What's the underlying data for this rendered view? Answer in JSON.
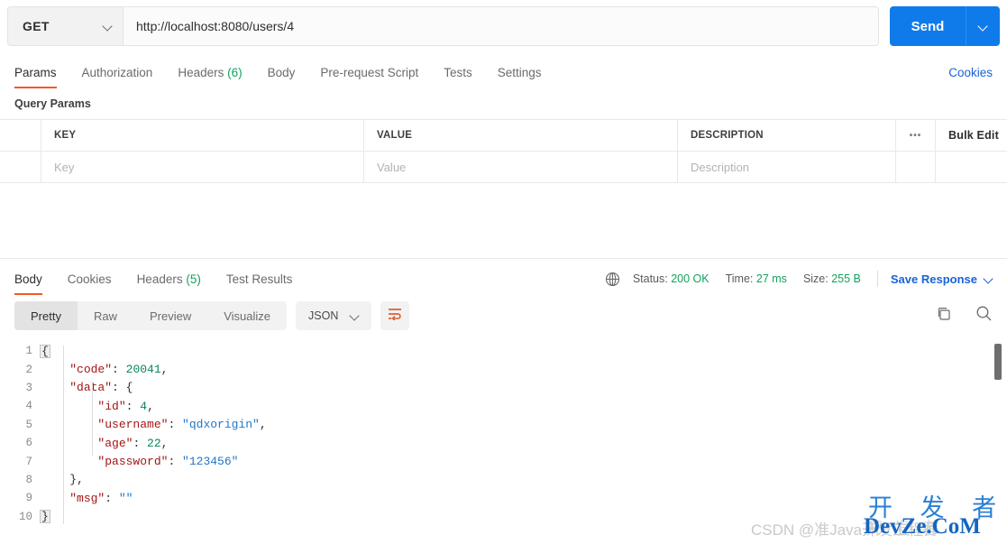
{
  "request": {
    "method": "GET",
    "url": "http://localhost:8080/users/4",
    "send_label": "Send",
    "tabs": [
      {
        "label": "Params",
        "count": "",
        "active": true
      },
      {
        "label": "Authorization",
        "count": "",
        "active": false
      },
      {
        "label": "Headers",
        "count": "(6)",
        "active": false
      },
      {
        "label": "Body",
        "count": "",
        "active": false
      },
      {
        "label": "Pre-request Script",
        "count": "",
        "active": false
      },
      {
        "label": "Tests",
        "count": "",
        "active": false
      },
      {
        "label": "Settings",
        "count": "",
        "active": false
      }
    ],
    "cookies_link": "Cookies"
  },
  "query_params": {
    "section_title": "Query Params",
    "columns": [
      "KEY",
      "VALUE",
      "DESCRIPTION"
    ],
    "dots_label": "•••",
    "bulk_edit_label": "Bulk Edit",
    "rows": [
      {
        "key_placeholder": "Key",
        "value_placeholder": "Value",
        "description_placeholder": "Description"
      }
    ]
  },
  "response": {
    "tabs": [
      {
        "label": "Body",
        "count": "",
        "active": true
      },
      {
        "label": "Cookies",
        "count": "",
        "active": false
      },
      {
        "label": "Headers",
        "count": "(5)",
        "active": false
      },
      {
        "label": "Test Results",
        "count": "",
        "active": false
      }
    ],
    "status": {
      "status_label": "Status:",
      "status_value": "200 OK",
      "time_label": "Time:",
      "time_value": "27 ms",
      "size_label": "Size:",
      "size_value": "255 B"
    },
    "save_response_label": "Save Response",
    "view_modes": [
      {
        "label": "Pretty",
        "active": true
      },
      {
        "label": "Raw",
        "active": false
      },
      {
        "label": "Preview",
        "active": false
      },
      {
        "label": "Visualize",
        "active": false
      }
    ],
    "format": "JSON",
    "body_lines": [
      {
        "num": "1",
        "text": "{"
      },
      {
        "num": "2",
        "text": "    \"code\": 20041,"
      },
      {
        "num": "3",
        "text": "    \"data\": {"
      },
      {
        "num": "4",
        "text": "        \"id\": 4,"
      },
      {
        "num": "5",
        "text": "        \"username\": \"qdxorigin\","
      },
      {
        "num": "6",
        "text": "        \"age\": 22,"
      },
      {
        "num": "7",
        "text": "        \"password\": \"123456\""
      },
      {
        "num": "8",
        "text": "    },"
      },
      {
        "num": "9",
        "text": "    \"msg\": \"\""
      },
      {
        "num": "10",
        "text": "}"
      }
    ],
    "body_json": {
      "code": 20041,
      "data": {
        "id": 4,
        "username": "qdxorigin",
        "age": 22,
        "password": "123456"
      },
      "msg": ""
    }
  },
  "watermarks": {
    "csdn": "CSDN @准Java开发工程师",
    "dev_cn": "开 发 者",
    "dev_en": "DevZe.CoM"
  },
  "colors": {
    "accent_orange": "#ef5b25",
    "blue": "#0f7beb",
    "link_blue": "#1763d9",
    "green": "#13a05c"
  }
}
